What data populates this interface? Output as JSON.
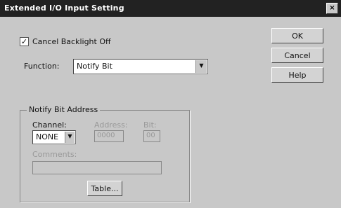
{
  "window": {
    "title": "Extended I/O Input Setting",
    "close_symbol": "×"
  },
  "options": {
    "cancel_backlight_off_label": "Cancel Backlight Off",
    "cancel_backlight_off_checked": true,
    "function_label": "Function:",
    "function_value": "Notify Bit"
  },
  "buttons": {
    "ok": "OK",
    "cancel": "Cancel",
    "help": "Help"
  },
  "notify_group": {
    "title": "Notify Bit Address",
    "channel_label": "Channel:",
    "channel_value": "NONE",
    "address_label": "Address:",
    "address_value": "0000",
    "bit_label": "Bit:",
    "bit_value": "00",
    "comments_label": "Comments:",
    "comments_value": "",
    "table_button": "Table..."
  }
}
